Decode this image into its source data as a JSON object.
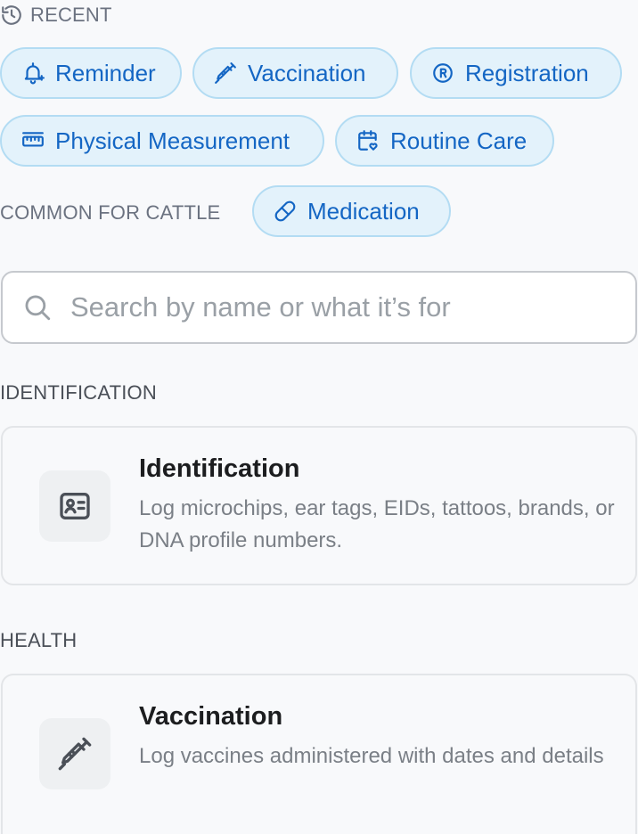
{
  "recent": {
    "heading": "RECENT",
    "chips": [
      {
        "label": "Reminder",
        "icon": "bell-plus-icon"
      },
      {
        "label": "Vaccination",
        "icon": "syringe-icon"
      },
      {
        "label": "Registration",
        "icon": "registered-icon"
      },
      {
        "label": "Physical Measurement",
        "icon": "ruler-icon"
      },
      {
        "label": "Routine Care",
        "icon": "calendar-heart-icon"
      }
    ]
  },
  "common": {
    "heading": "COMMON FOR CATTLE",
    "chips": [
      {
        "label": "Medication",
        "icon": "pill-icon"
      }
    ]
  },
  "search": {
    "placeholder": "Search by name or what it’s for",
    "value": ""
  },
  "sections": [
    {
      "heading": "IDENTIFICATION",
      "cards": [
        {
          "title": "Identification",
          "description": "Log microchips, ear tags, EIDs, tattoos, brands, or DNA profile numbers.",
          "icon": "id-card-icon"
        }
      ]
    },
    {
      "heading": "HEALTH",
      "cards": [
        {
          "title": "Vaccination",
          "description": "Log vaccines administered with dates and details",
          "icon": "syringe-icon"
        }
      ]
    }
  ],
  "colors": {
    "chip_text": "#1466c4",
    "chip_bg": "#e3f2fb",
    "chip_border": "#b3dcf3",
    "background": "#f8f9fb"
  }
}
